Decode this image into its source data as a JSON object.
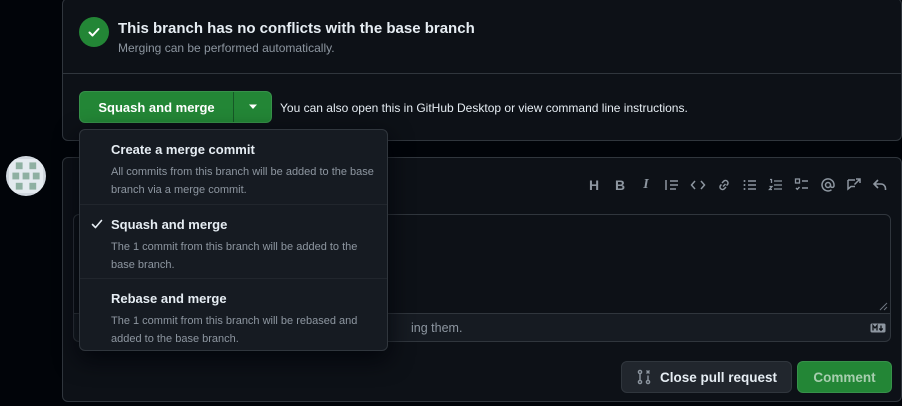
{
  "merge_status": {
    "title": "This branch has no conflicts with the base branch",
    "subtitle": "Merging can be performed automatically.",
    "check_icon": "check-icon"
  },
  "merge_button": {
    "label": "Squash and merge",
    "caret_icon": "triangle-down-icon"
  },
  "alt_text": {
    "prefix": "You can also",
    "desktop_link": "open this in GitHub Desktop",
    "middle": "or view",
    "cli_link": "command line instructions",
    "suffix": "."
  },
  "merge_menu": {
    "items": [
      {
        "title": "Create a merge commit",
        "description": "All commits from this branch will be added to the base branch via a merge commit.",
        "selected": false
      },
      {
        "title": "Squash and merge",
        "description": "The 1 commit from this branch will be added to the base branch.",
        "selected": true
      },
      {
        "title": "Rebase and merge",
        "description": "The 1 commit from this branch will be rebased and added to the base branch.",
        "selected": false
      }
    ]
  },
  "comment_toolbar": {
    "icons": [
      "heading-icon",
      "bold-icon",
      "italic-icon",
      "quote-icon",
      "code-icon",
      "link-icon",
      "unordered-list-icon",
      "ordered-list-icon",
      "task-list-icon",
      "mention-icon",
      "cross-reference-icon",
      "reply-icon"
    ],
    "heading_label": "H",
    "bold_label": "B",
    "italic_label": "I"
  },
  "comment_editor": {
    "attach_hint_visible": "ing them.",
    "markdown_icon": "markdown-icon"
  },
  "actions": {
    "close_label": "Close pull request",
    "comment_label": "Comment",
    "close_icon": "git-pull-request-closed-icon"
  },
  "colors": {
    "background": "#010409",
    "panel": "#0d1117",
    "border": "#30363d",
    "green": "#238636",
    "muted_text": "#8d96a0",
    "text": "#e6edf3"
  }
}
